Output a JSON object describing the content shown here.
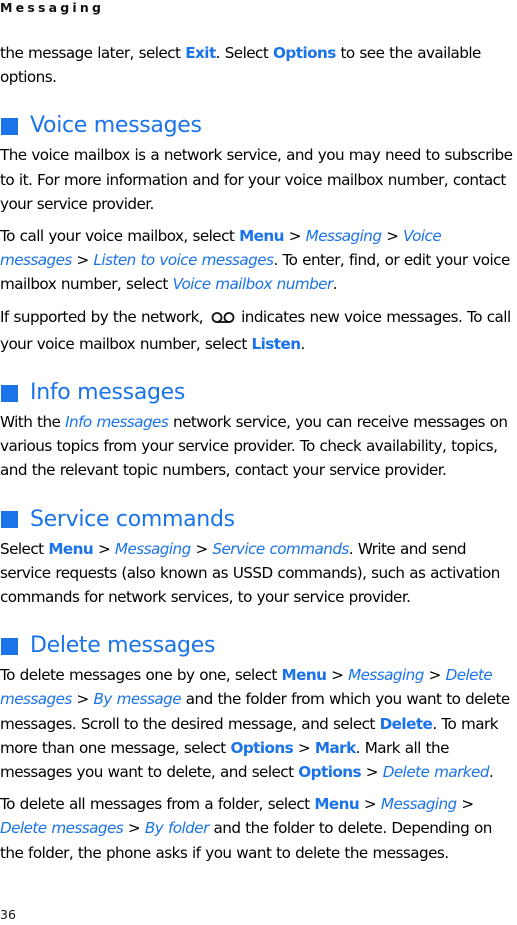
{
  "header": {
    "running_title": "Messaging"
  },
  "intro": {
    "t1": "the message later, select ",
    "exit": "Exit",
    "t2": ". Select ",
    "options": "Options",
    "t3": " to see the available options."
  },
  "voice": {
    "heading": "Voice messages",
    "p1": "The voice mailbox is a network service, and you may need to subscribe to it. For more information and for your voice mailbox number, contact your service provider.",
    "p2": {
      "t1": "To call your voice mailbox, select ",
      "menu": "Menu",
      "sep": " > ",
      "messaging": "Messaging",
      "voice_messages": "Voice messages",
      "listen_to": "Listen to voice messages",
      "t2": ". To enter, find, or edit your voice mailbox number, select ",
      "vm_number": "Voice mailbox number",
      "t3": "."
    },
    "p3": {
      "t1": "If supported by the network,",
      "icon": "voicemail-icon",
      "t2": "indicates new voice messages. To call your voice mailbox number, select ",
      "listen": "Listen",
      "t3": "."
    }
  },
  "info": {
    "heading": "Info messages",
    "t1": "With the ",
    "info_messages": "Info messages",
    "t2": " network service, you can receive messages on various topics from your service provider. To check availability, topics, and the relevant topic numbers, contact your service provider."
  },
  "service": {
    "heading": "Service commands",
    "t1": "Select ",
    "menu": "Menu",
    "sep": " > ",
    "messaging": "Messaging",
    "service_commands": "Service commands",
    "t2": ". Write and send service requests (also known as USSD commands), such as activation commands for network services, to your service provider."
  },
  "delete": {
    "heading": "Delete messages",
    "p1": {
      "t1": "To delete messages one by one, select ",
      "menu": "Menu",
      "sep": " > ",
      "messaging": "Messaging",
      "delete_messages": "Delete messages",
      "by_message": "By message",
      "t2": " and the folder from which you want to delete messages. Scroll to the desired message, and select ",
      "delete": "Delete",
      "t3": ". To mark more than one message, select ",
      "options": "Options",
      "mark": "Mark",
      "t4": ". Mark all the messages you want to delete, and select ",
      "delete_marked": "Delete marked",
      "t5": "."
    },
    "p2": {
      "t1": "To delete all messages from a folder, select ",
      "menu": "Menu",
      "sep": " > ",
      "messaging": "Messaging",
      "delete_messages": "Delete messages",
      "by_folder": "By folder",
      "t2": " and the folder to delete. Depending on the folder, the phone asks if you want to delete the messages."
    }
  },
  "footer": {
    "page_number": "36"
  },
  "colors": {
    "accent": "#1a73e8",
    "text": "#000000"
  }
}
